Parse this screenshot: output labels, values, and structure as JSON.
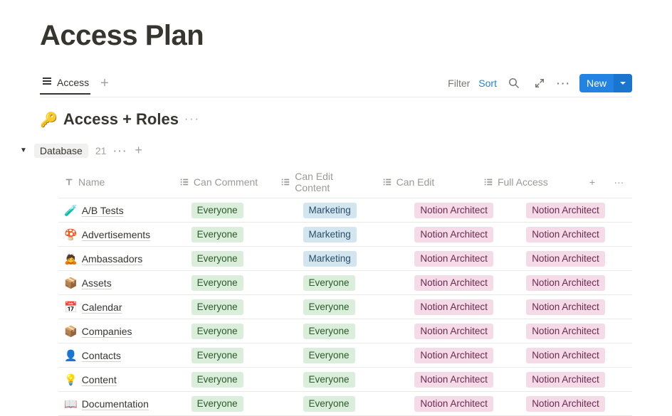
{
  "page": {
    "title": "Access Plan"
  },
  "tabs": {
    "active": {
      "label": "Access"
    }
  },
  "toolbar": {
    "filter": "Filter",
    "sort": "Sort",
    "new_label": "New"
  },
  "database": {
    "emoji": "🔑",
    "title": "Access + Roles"
  },
  "group": {
    "label": "Database",
    "count": "21"
  },
  "columns": {
    "name": "Name",
    "can_comment": "Can Comment",
    "can_edit_content": "Can Edit Content",
    "can_edit": "Can Edit",
    "full_access": "Full Access"
  },
  "tags": {
    "everyone": {
      "label": "Everyone",
      "color": "green"
    },
    "marketing": {
      "label": "Marketing",
      "color": "blue"
    },
    "notion_architect": {
      "label": "Notion Architect",
      "color": "pink"
    }
  },
  "rows": [
    {
      "emoji": "🧪",
      "name": "A/B Tests",
      "can_comment": "everyone",
      "can_edit_content": "marketing",
      "can_edit": "notion_architect",
      "full_access": "notion_architect"
    },
    {
      "emoji": "🍄",
      "name": "Advertisements",
      "can_comment": "everyone",
      "can_edit_content": "marketing",
      "can_edit": "notion_architect",
      "full_access": "notion_architect"
    },
    {
      "emoji": "🙇",
      "name": "Ambassadors",
      "can_comment": "everyone",
      "can_edit_content": "marketing",
      "can_edit": "notion_architect",
      "full_access": "notion_architect"
    },
    {
      "emoji": "📦",
      "name": "Assets",
      "can_comment": "everyone",
      "can_edit_content": "everyone",
      "can_edit": "notion_architect",
      "full_access": "notion_architect"
    },
    {
      "emoji": "📅",
      "name": "Calendar",
      "can_comment": "everyone",
      "can_edit_content": "everyone",
      "can_edit": "notion_architect",
      "full_access": "notion_architect"
    },
    {
      "emoji": "📦",
      "name": "Companies",
      "can_comment": "everyone",
      "can_edit_content": "everyone",
      "can_edit": "notion_architect",
      "full_access": "notion_architect"
    },
    {
      "emoji": "👤",
      "name": "Contacts",
      "can_comment": "everyone",
      "can_edit_content": "everyone",
      "can_edit": "notion_architect",
      "full_access": "notion_architect"
    },
    {
      "emoji": "💡",
      "name": "Content",
      "can_comment": "everyone",
      "can_edit_content": "everyone",
      "can_edit": "notion_architect",
      "full_access": "notion_architect"
    },
    {
      "emoji": "📖",
      "name": "Documentation",
      "can_comment": "everyone",
      "can_edit_content": "everyone",
      "can_edit": "notion_architect",
      "full_access": "notion_architect"
    }
  ]
}
